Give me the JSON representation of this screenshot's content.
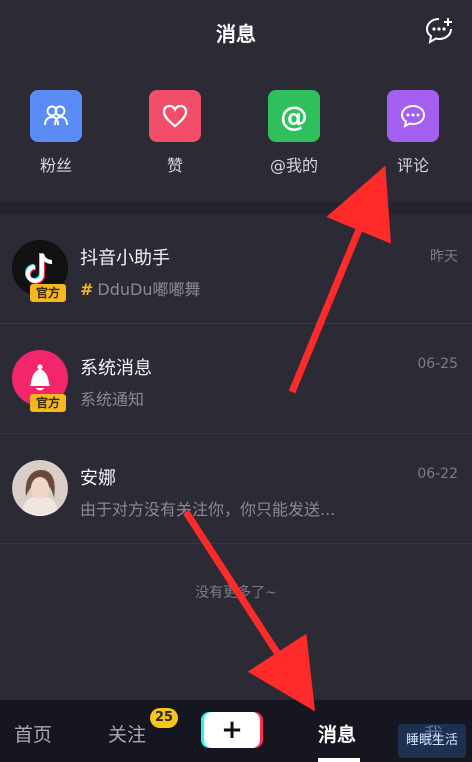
{
  "header": {
    "title": "消息",
    "chat_icon": "add-chat-icon"
  },
  "quick_actions": [
    {
      "label": "粉丝",
      "icon": "fans-icon",
      "color": "#5b8cf5"
    },
    {
      "label": "赞",
      "icon": "heart-icon",
      "color": "#f24e6b"
    },
    {
      "label": "@我的",
      "icon": "at-icon",
      "color": "#2fbf5c"
    },
    {
      "label": "评论",
      "icon": "comment-icon",
      "color": "#a45ef0"
    }
  ],
  "messages": [
    {
      "name": "抖音小助手",
      "subtitle": "DduDu嘟嘟舞",
      "time": "昨天",
      "badge": "官方",
      "has_hash": true,
      "avatar": "tiktok-logo-icon"
    },
    {
      "name": "系统消息",
      "subtitle": "系统通知",
      "time": "06-25",
      "badge": "官方",
      "avatar": "bell-icon"
    },
    {
      "name": "安娜",
      "subtitle": "由于对方没有关注你，你只能发送...",
      "time": "06-22",
      "avatar": "user-photo"
    }
  ],
  "no_more_text": "没有更多了~",
  "tabbar": {
    "home": "首页",
    "follow": "关注",
    "follow_badge": "25",
    "plus": "+",
    "messages": "消息",
    "me": "我"
  },
  "watermark_text": "睡眠生活",
  "colors": {
    "background": "#2b2a35",
    "tabbar": "#161620",
    "accent_badge": "#f5c518",
    "arrow": "#ff2b2b"
  }
}
